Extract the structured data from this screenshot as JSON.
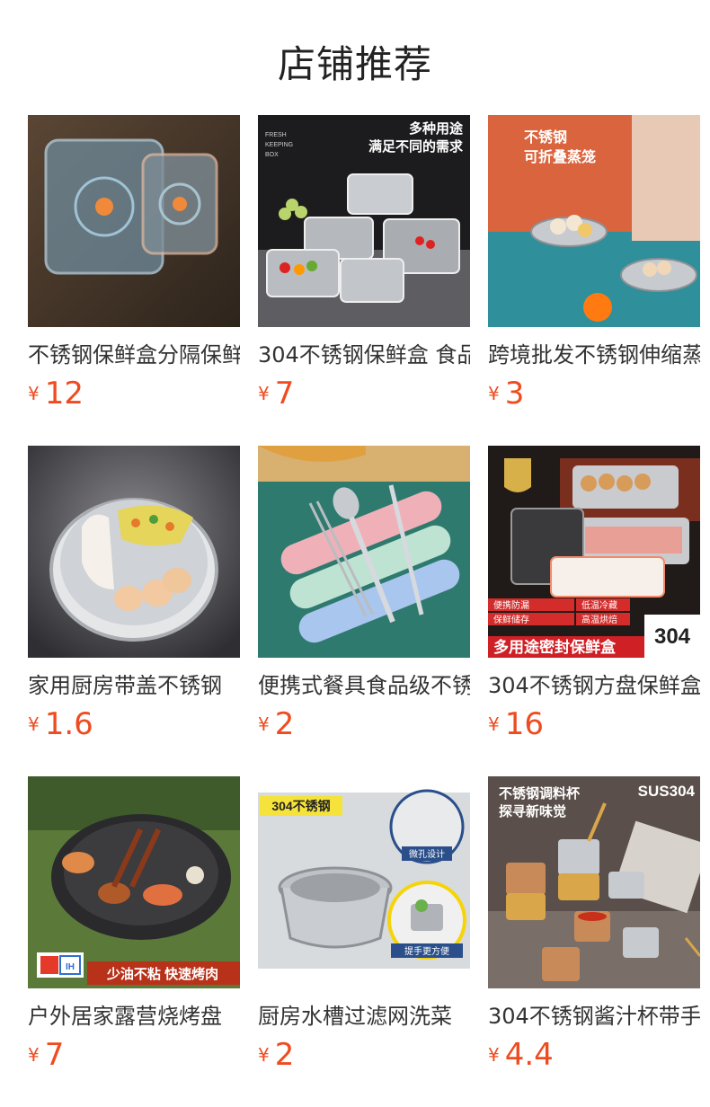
{
  "shop": {
    "title": "店铺推荐",
    "accent": "#ef4b1f"
  },
  "products": [
    {
      "name": "不锈钢保鲜盒分隔保鲜",
      "currency": "¥",
      "price": "12",
      "image": "food-container-photo"
    },
    {
      "name": "304不锈钢保鲜盒 食品",
      "currency": "¥",
      "price": "7",
      "image": "fresh-keeping-box-photo",
      "image_text": [
        "多种用途",
        "满足不同的需求",
        "FRESH",
        "KEEPING",
        "BOX"
      ]
    },
    {
      "name": "跨境批发不锈钢伸缩蒸",
      "currency": "¥",
      "price": "3",
      "image": "folding-steamer-photo",
      "image_text": [
        "不锈钢",
        "可折叠蒸笼"
      ]
    },
    {
      "name": "家用厨房带盖不锈钢",
      "currency": "¥",
      "price": "1.6",
      "image": "steamer-tray-photo"
    },
    {
      "name": "便携式餐具食品级不锈",
      "currency": "¥",
      "price": "2",
      "image": "cutlery-set-photo"
    },
    {
      "name": "304不锈钢方盘保鲜盒",
      "currency": "¥",
      "price": "16",
      "image": "sealed-box-photo",
      "image_text": [
        "304",
        "多用途密封保鲜盒",
        "便携防漏",
        "低温冷藏",
        "保鲜储存",
        "高温烘焙"
      ]
    },
    {
      "name": "户外居家露营烧烤盘",
      "currency": "¥",
      "price": "7",
      "image": "grill-pan-photo",
      "image_text": [
        "少油不粘 快速烤肉",
        "IH"
      ]
    },
    {
      "name": "厨房水槽过滤网洗菜",
      "currency": "¥",
      "price": "2",
      "image": "sink-strainer-photo",
      "image_text": [
        "304不锈钢",
        "微孔设计",
        "提手更方便"
      ]
    },
    {
      "name": "304不锈钢酱汁杯带手",
      "currency": "¥",
      "price": "4.4",
      "image": "sauce-cup-photo",
      "image_text": [
        "不锈钢调料杯",
        "探寻新味觉",
        "SUS304"
      ]
    }
  ]
}
